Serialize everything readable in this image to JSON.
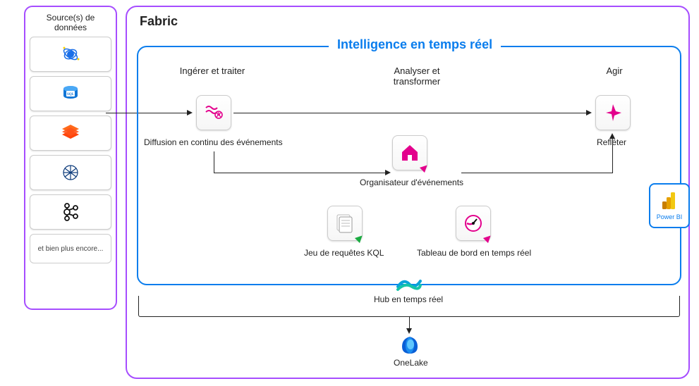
{
  "sources": {
    "title": "Source(s) de données",
    "items": [
      {
        "name": "cosmos"
      },
      {
        "name": "sql"
      },
      {
        "name": "databricks"
      },
      {
        "name": "confluent"
      },
      {
        "name": "kafka"
      }
    ],
    "more_label": "et bien plus encore..."
  },
  "fabric": {
    "title": "Fabric",
    "rti": {
      "title": "Intelligence en temps réel",
      "columns": {
        "ingest": "Ingérer et traiter",
        "analyze": "Analyser et\ntransformer",
        "act": "Agir"
      },
      "nodes": {
        "eventstream": "Diffusion en continu des événements",
        "eventhouse": "Organisateur d'événements",
        "kql_queryset": "Jeu de requêtes KQL",
        "realtime_dashboard": "Tableau de bord en temps réel",
        "reflect": "Refléter"
      }
    },
    "powerbi": "Power BI",
    "hub": "Hub en temps réel",
    "onelake": "OneLake"
  }
}
